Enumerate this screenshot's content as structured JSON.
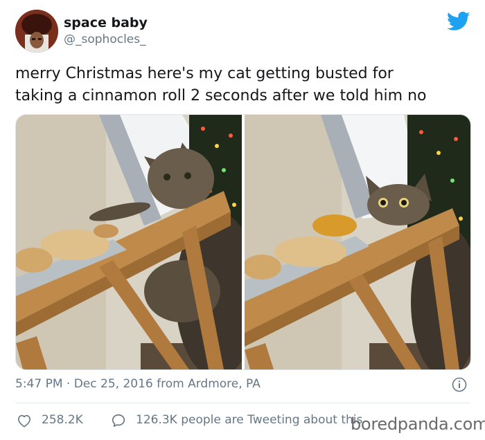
{
  "author": {
    "name": "space baby",
    "handle": "@_sophocles_"
  },
  "tweet": {
    "line1": "merry Christmas here's my cat getting busted for",
    "line2": "taking a cinnamon roll 2 seconds after we told him no"
  },
  "meta": {
    "timestamp": "5:47 PM · Dec 25, 2016 from Ardmore, PA"
  },
  "actions": {
    "likes": "258.2K",
    "replies_text": "126.3K people are Tweeting about this"
  },
  "watermark": "boredpanda.com",
  "icons": {
    "bird": "twitter-bird-icon",
    "info": "info-icon",
    "like": "heart-icon",
    "reply": "speech-bubble-icon"
  },
  "colors": {
    "brand": "#1da1f2",
    "text": "#14171a",
    "muted": "#657786"
  }
}
